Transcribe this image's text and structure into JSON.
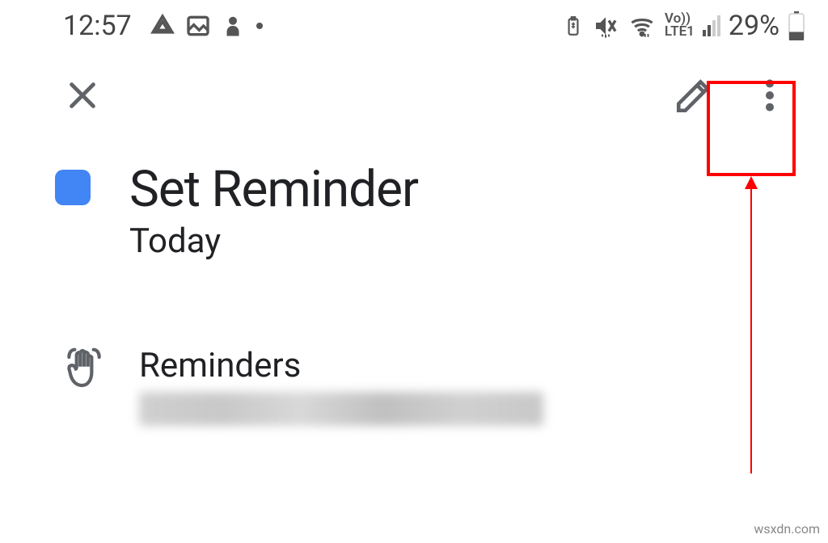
{
  "status": {
    "time": "12:57",
    "battery_percent": "29%",
    "lte_label": "LTE1",
    "vo_label": "Vo))"
  },
  "toolbar": {
    "close": "close",
    "edit": "edit",
    "more": "more"
  },
  "reminder": {
    "title": "Set Reminder",
    "date": "Today"
  },
  "section": {
    "label": "Reminders"
  },
  "watermark": "wsxdn.com"
}
